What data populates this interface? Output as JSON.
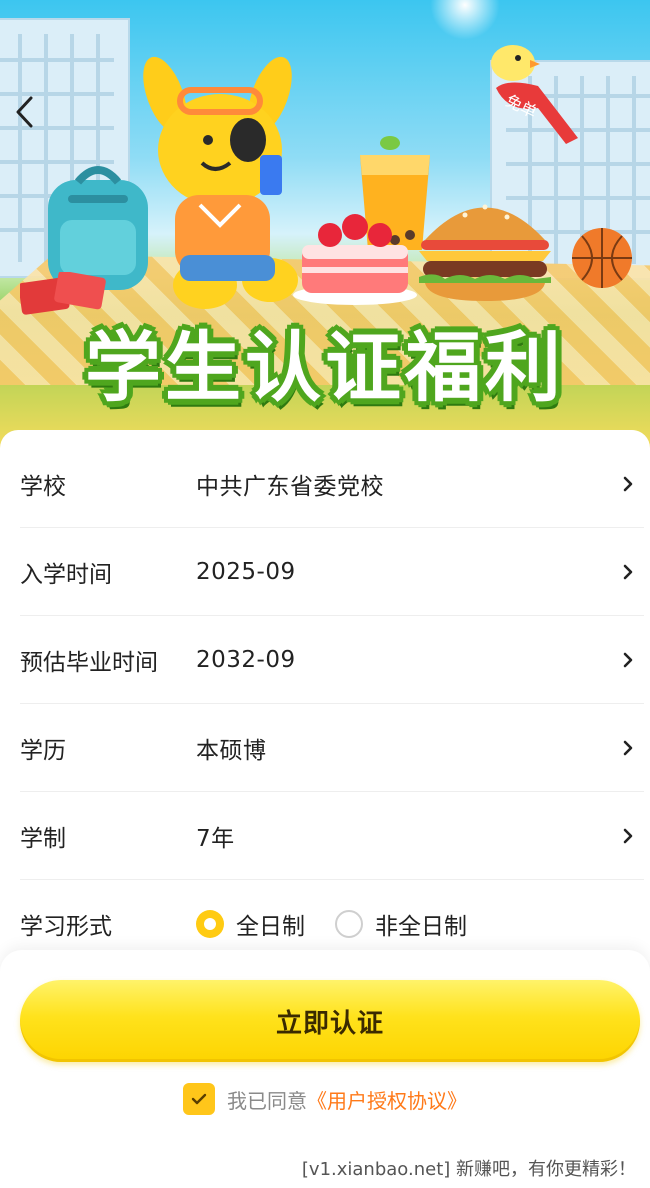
{
  "banner": {
    "headline": "学生认证福利",
    "bird_badge": "免单"
  },
  "form": {
    "rows": [
      {
        "label": "学校",
        "value": "中共广东省委党校"
      },
      {
        "label": "入学时间",
        "value": "2025-09"
      },
      {
        "label": "预估毕业时间",
        "value": "2032-09"
      },
      {
        "label": "学历",
        "value": "本硕博"
      },
      {
        "label": "学制",
        "value": "7年"
      }
    ],
    "mode": {
      "label": "学习形式",
      "options": [
        {
          "label": "全日制",
          "selected": true
        },
        {
          "label": "非全日制",
          "selected": false
        }
      ]
    }
  },
  "actions": {
    "submit_label": "立即认证",
    "agree_prefix": "我已同意",
    "agreement_link": "《用户授权协议》",
    "agree_checked": true
  },
  "watermark": "[v1.xianbao.net] 新赚吧，有你更精彩！",
  "colors": {
    "accent": "#ffcb12",
    "link": "#ff7a1a",
    "headline_outline": "#4fa61e"
  }
}
